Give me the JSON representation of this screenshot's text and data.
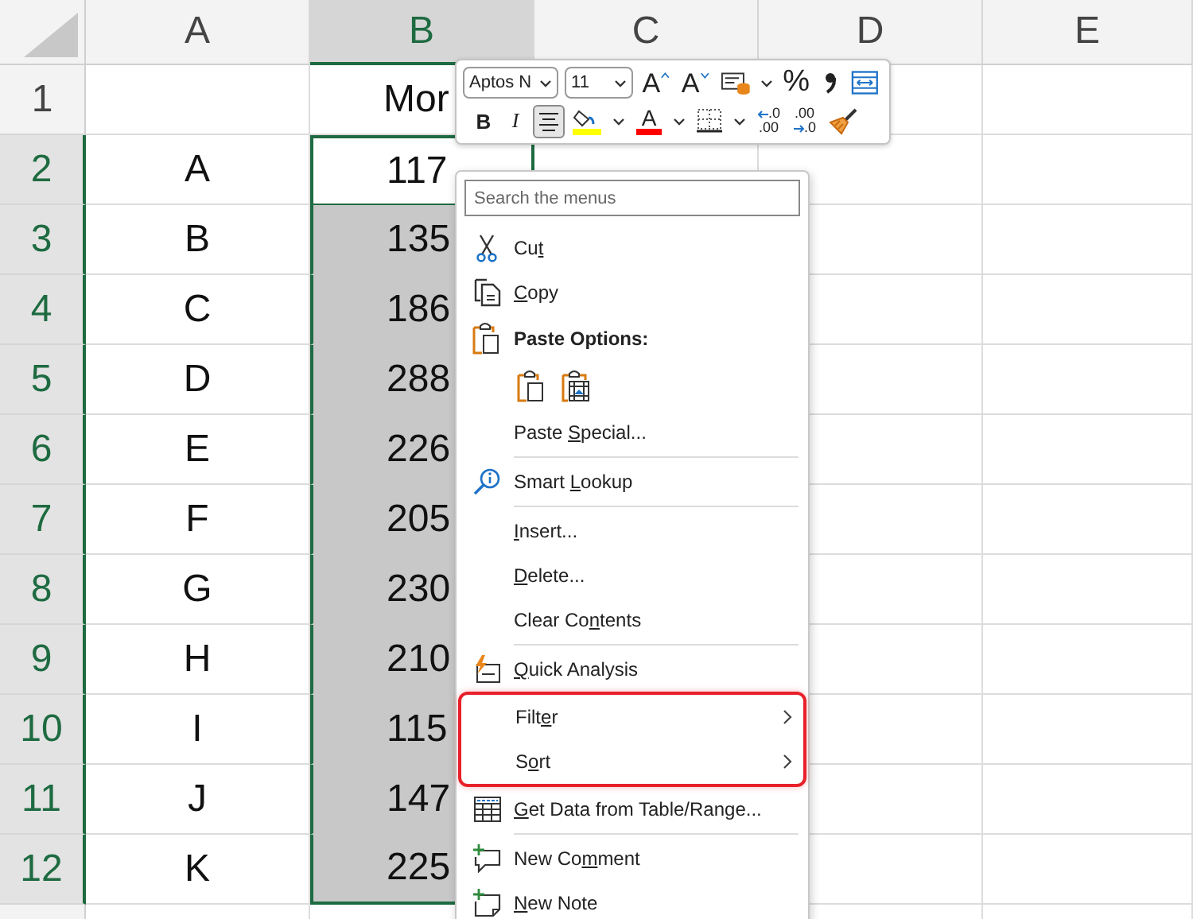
{
  "columns": [
    {
      "label": "A",
      "selected": false
    },
    {
      "label": "B",
      "selected": true
    },
    {
      "label": "C",
      "selected": false
    },
    {
      "label": "D",
      "selected": false
    },
    {
      "label": "E",
      "selected": false
    }
  ],
  "rows": [
    {
      "number": "1",
      "selected": false,
      "b_selected": false,
      "b_active": false,
      "b": "Mor"
    },
    {
      "number": "2",
      "selected": true,
      "b_selected": true,
      "b_active": true,
      "a": "A",
      "b": "117"
    },
    {
      "number": "3",
      "selected": true,
      "b_selected": true,
      "b_active": false,
      "a": "B",
      "b": "135"
    },
    {
      "number": "4",
      "selected": true,
      "b_selected": true,
      "b_active": false,
      "a": "C",
      "b": "186"
    },
    {
      "number": "5",
      "selected": true,
      "b_selected": true,
      "b_active": false,
      "a": "D",
      "b": "288"
    },
    {
      "number": "6",
      "selected": true,
      "b_selected": true,
      "b_active": false,
      "a": "E",
      "b": "226"
    },
    {
      "number": "7",
      "selected": true,
      "b_selected": true,
      "b_active": false,
      "a": "F",
      "b": "205"
    },
    {
      "number": "8",
      "selected": true,
      "b_selected": true,
      "b_active": false,
      "a": "G",
      "b": "230"
    },
    {
      "number": "9",
      "selected": true,
      "b_selected": true,
      "b_active": false,
      "a": "H",
      "b": "210"
    },
    {
      "number": "10",
      "selected": true,
      "b_selected": true,
      "b_active": false,
      "a": "I",
      "b": "115"
    },
    {
      "number": "11",
      "selected": true,
      "b_selected": true,
      "b_active": false,
      "a": "J",
      "b": "147"
    },
    {
      "number": "12",
      "selected": true,
      "b_selected": true,
      "b_active": false,
      "a": "K",
      "b": "225"
    }
  ],
  "mini_toolbar": {
    "font_name": "Aptos N",
    "font_size": "11",
    "row1": [
      {
        "kind": "grow",
        "glyph": "A"
      },
      {
        "kind": "shrink",
        "glyph": "A"
      },
      {
        "kind": "styles",
        "dropdown": true
      },
      {
        "kind": "percent",
        "glyph": "%"
      },
      {
        "kind": "comma"
      },
      {
        "kind": "wrap"
      }
    ],
    "row2": [
      {
        "kind": "bold",
        "glyph": "B"
      },
      {
        "kind": "italic",
        "glyph": "I"
      },
      {
        "kind": "align",
        "selected": true
      },
      {
        "kind": "fill",
        "dropdown": true
      },
      {
        "kind": "fontcolor",
        "glyph": "A",
        "dropdown": true
      },
      {
        "kind": "borders",
        "dropdown": true
      },
      {
        "kind": "decdec",
        "top": ".0",
        "bottom": ".00"
      },
      {
        "kind": "incdec",
        "top": ".00",
        "bottom": ".0"
      },
      {
        "kind": "painter"
      }
    ]
  },
  "context_menu": {
    "search_placeholder": "Search the menus",
    "items": [
      {
        "kind": "cut",
        "label": {
          "before": "Cu",
          "key": "t"
        }
      },
      {
        "kind": "copy",
        "label": {
          "key": "C",
          "after": "opy"
        }
      },
      {
        "kind": "heading",
        "label": {
          "before": "Paste Options:"
        }
      },
      {
        "kind": "paste_options",
        "options": [
          {
            "kind": "paste"
          },
          {
            "kind": "paste_picture"
          }
        ]
      },
      {
        "kind": "plain",
        "label": {
          "before": "Paste ",
          "key": "S",
          "after": "pecial..."
        }
      },
      {
        "kind": "divider"
      },
      {
        "kind": "lookup",
        "label": {
          "before": "Smart ",
          "key": "L",
          "after": "ookup"
        }
      },
      {
        "kind": "divider"
      },
      {
        "kind": "plain",
        "label": {
          "key": "I",
          "after": "nsert..."
        }
      },
      {
        "kind": "plain",
        "label": {
          "key": "D",
          "after": "elete..."
        }
      },
      {
        "kind": "plain",
        "label": {
          "before": "Clear Co",
          "key": "n",
          "after": "tents"
        }
      },
      {
        "kind": "divider"
      },
      {
        "kind": "quick_analysis",
        "label": {
          "key": "Q",
          "after": "uick Analysis"
        }
      },
      {
        "kind": "group",
        "outlined": true,
        "items": [
          {
            "label": {
              "before": "Filt",
              "key": "e",
              "after": "r"
            },
            "submenu": true
          },
          {
            "label": {
              "before": "S",
              "key": "o",
              "after": "rt"
            },
            "submenu": true
          }
        ]
      },
      {
        "kind": "get_data",
        "label": {
          "key": "G",
          "after": "et Data from Table/Range..."
        }
      },
      {
        "kind": "divider"
      },
      {
        "kind": "comment",
        "label": {
          "before": "New Co",
          "key": "m",
          "after": "ment"
        }
      },
      {
        "kind": "note",
        "label": {
          "key": "N",
          "after": "ew Note"
        }
      }
    ]
  }
}
